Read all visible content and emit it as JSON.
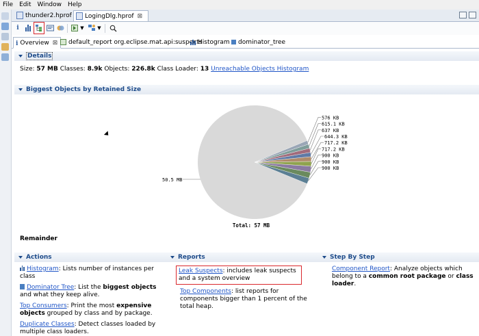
{
  "menu": [
    "File",
    "Edit",
    "Window",
    "Help"
  ],
  "editor_tabs": [
    {
      "label": "thunder2.hprof",
      "active": false
    },
    {
      "label": "LogingDlg.hprof",
      "active": true
    }
  ],
  "toolbar": {
    "icons": [
      "info-icon",
      "histogram-icon",
      "dominator-tree-icon",
      "oql-icon",
      "heap-dump-icon",
      "run-report-icon",
      "query-browser-icon",
      "search-icon"
    ]
  },
  "view_tabs": [
    {
      "label": "Overview",
      "active": true
    },
    {
      "label": "default_report  org.eclipse.mat.api:suspects",
      "active": false
    },
    {
      "label": "Histogram",
      "active": false
    },
    {
      "label": "dominator_tree",
      "active": false
    }
  ],
  "details": {
    "header": "Details",
    "size_label": "Size:",
    "size_value": "57 MB",
    "classes_label": "Classes:",
    "classes_value": "8.9k",
    "objects_label": "Objects:",
    "objects_value": "226.8k",
    "loader_label": "Class Loader:",
    "loader_value": "13",
    "unreachable_link": "Unreachable Objects Histogram"
  },
  "biggest": {
    "header": "Biggest Objects by Retained Size"
  },
  "chart_data": {
    "type": "pie",
    "title": "",
    "total_label": "Total: 57 MB",
    "slices": [
      {
        "label": "50.5 MB",
        "value": 50.5,
        "color": "#d9d9d9"
      },
      {
        "label": "900 KB",
        "value": 0.879,
        "color": "#5b7f94"
      },
      {
        "label": "900 KB",
        "value": 0.879,
        "color": "#6a8a5e"
      },
      {
        "label": "900 KB",
        "value": 0.879,
        "color": "#8a7aa1"
      },
      {
        "label": "717.2 KB",
        "value": 0.7,
        "color": "#8fa34e"
      },
      {
        "label": "717.2 KB",
        "value": 0.7,
        "color": "#b08b6a"
      },
      {
        "label": "644.3 KB",
        "value": 0.629,
        "color": "#5f7aa6"
      },
      {
        "label": "637 KB",
        "value": 0.622,
        "color": "#a26b7b"
      },
      {
        "label": "615.1 KB",
        "value": 0.601,
        "color": "#7f9d9a"
      },
      {
        "label": "576 KB",
        "value": 0.563,
        "color": "#9aa6b6"
      }
    ]
  },
  "remainder_label": "Remainder",
  "actions": {
    "header": "Actions",
    "items": [
      {
        "link": "Histogram",
        "text_1": ": Lists number of instances per class"
      },
      {
        "link": "Dominator Tree",
        "text_1": ": List the ",
        "bold": "biggest objects",
        "text_2": " and what they keep alive."
      },
      {
        "link": "Top Consumers",
        "text_1": ": Print the most ",
        "bold": "expensive objects",
        "text_2": " grouped by class and by package."
      },
      {
        "link": "Duplicate Classes",
        "text_1": ": Detect classes loaded by multiple class loaders."
      }
    ]
  },
  "reports": {
    "header": "Reports",
    "items": [
      {
        "link": "Leak Suspects",
        "text_1": ": includes leak suspects and a system overview"
      },
      {
        "link": "Top Components",
        "text_1": ": list reports for components bigger than 1 percent of the total heap."
      }
    ]
  },
  "steps": {
    "header": "Step By Step",
    "items": [
      {
        "link": "Component Report",
        "text_1": ": Analyze objects which belong to a ",
        "bold": "common root package",
        "text_2": " or ",
        "bold2": "class loader",
        "text_3": "."
      }
    ]
  },
  "colors": {
    "accent": "#1d4b8a",
    "link": "#1f55c7",
    "highlight": "#d9262b"
  }
}
